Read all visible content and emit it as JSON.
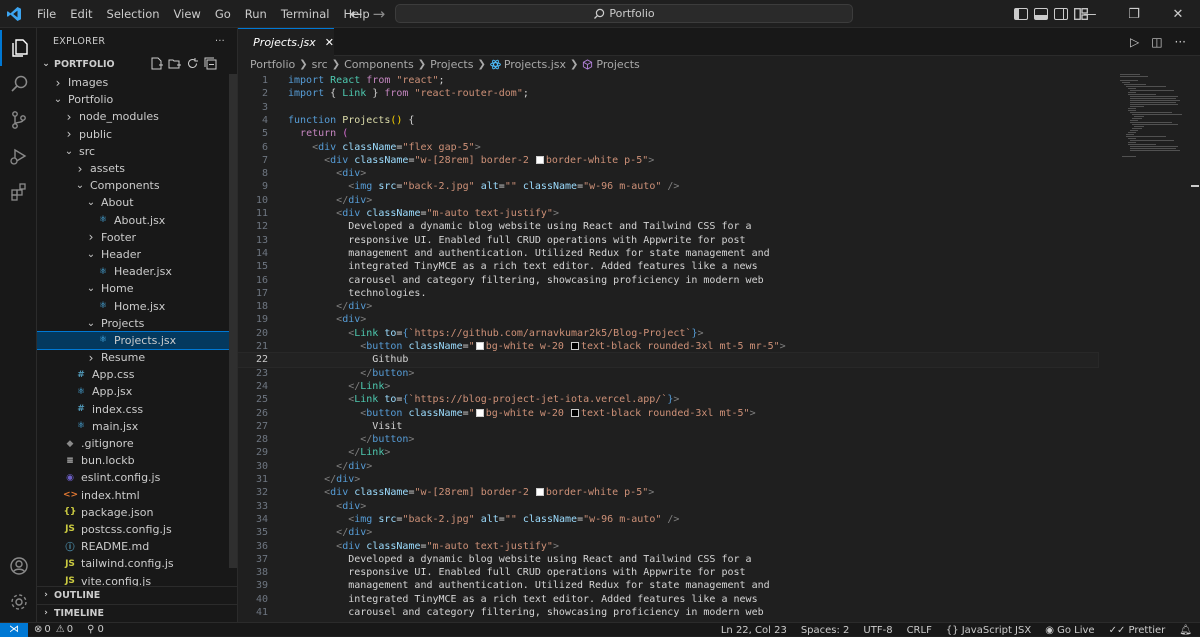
{
  "menu": [
    "File",
    "Edit",
    "Selection",
    "View",
    "Go",
    "Run",
    "Terminal",
    "Help"
  ],
  "command_center": "Portfolio",
  "explorer": {
    "title": "EXPLORER",
    "more": "···",
    "project": "PORTFOLIO",
    "tree": [
      {
        "label": "Images",
        "depth": 1,
        "type": "folder",
        "open": false
      },
      {
        "label": "Portfolio",
        "depth": 1,
        "type": "folder",
        "open": true
      },
      {
        "label": "node_modules",
        "depth": 2,
        "type": "folder",
        "open": false
      },
      {
        "label": "public",
        "depth": 2,
        "type": "folder",
        "open": false
      },
      {
        "label": "src",
        "depth": 2,
        "type": "folder",
        "open": true
      },
      {
        "label": "assets",
        "depth": 3,
        "type": "folder",
        "open": false
      },
      {
        "label": "Components",
        "depth": 3,
        "type": "folder",
        "open": true
      },
      {
        "label": "About",
        "depth": 4,
        "type": "folder",
        "open": true
      },
      {
        "label": "About.jsx",
        "depth": 5,
        "type": "react"
      },
      {
        "label": "Footer",
        "depth": 4,
        "type": "folder",
        "open": false
      },
      {
        "label": "Header",
        "depth": 4,
        "type": "folder",
        "open": true
      },
      {
        "label": "Header.jsx",
        "depth": 5,
        "type": "react"
      },
      {
        "label": "Home",
        "depth": 4,
        "type": "folder",
        "open": true
      },
      {
        "label": "Home.jsx",
        "depth": 5,
        "type": "react"
      },
      {
        "label": "Projects",
        "depth": 4,
        "type": "folder",
        "open": true
      },
      {
        "label": "Projects.jsx",
        "depth": 5,
        "type": "react",
        "selected": true
      },
      {
        "label": "Resume",
        "depth": 4,
        "type": "folder",
        "open": false
      },
      {
        "label": "App.css",
        "depth": 3,
        "type": "css"
      },
      {
        "label": "App.jsx",
        "depth": 3,
        "type": "react"
      },
      {
        "label": "index.css",
        "depth": 3,
        "type": "css"
      },
      {
        "label": "main.jsx",
        "depth": 3,
        "type": "react"
      },
      {
        "label": ".gitignore",
        "depth": 2,
        "type": "git"
      },
      {
        "label": "bun.lockb",
        "depth": 2,
        "type": "lock"
      },
      {
        "label": "eslint.config.js",
        "depth": 2,
        "type": "eslint"
      },
      {
        "label": "index.html",
        "depth": 2,
        "type": "html"
      },
      {
        "label": "package.json",
        "depth": 2,
        "type": "json"
      },
      {
        "label": "postcss.config.js",
        "depth": 2,
        "type": "js"
      },
      {
        "label": "README.md",
        "depth": 2,
        "type": "info"
      },
      {
        "label": "tailwind.config.js",
        "depth": 2,
        "type": "js"
      },
      {
        "label": "vite.config.js",
        "depth": 2,
        "type": "js"
      }
    ],
    "outline": "OUTLINE",
    "timeline": "TIMELINE"
  },
  "tab": {
    "label": "Projects.jsx"
  },
  "breadcrumb": [
    "Portfolio",
    "src",
    "Components",
    "Projects",
    "Projects.jsx",
    "Projects"
  ],
  "current_line": 22,
  "code": [
    [
      [
        "k",
        "import "
      ],
      [
        "c",
        "React "
      ],
      [
        "kc",
        "from "
      ],
      [
        "s",
        "\"react\""
      ],
      [
        "w",
        ";"
      ]
    ],
    [
      [
        "k",
        "import "
      ],
      [
        "w",
        "{ "
      ],
      [
        "c",
        "Link "
      ],
      [
        "w",
        "} "
      ],
      [
        "kc",
        "from "
      ],
      [
        "s",
        "\"react-router-dom\""
      ],
      [
        "w",
        ";"
      ]
    ],
    [],
    [
      [
        "k",
        "function "
      ],
      [
        "f",
        "Projects"
      ],
      [
        "y",
        "()"
      ],
      [
        "w",
        " {"
      ]
    ],
    [
      [
        "w",
        "  "
      ],
      [
        "kc",
        "return "
      ],
      [
        "p",
        "("
      ]
    ],
    [
      [
        "w",
        "    "
      ],
      [
        "g",
        "<"
      ],
      [
        "t",
        "div "
      ],
      [
        "v",
        "className"
      ],
      [
        "w",
        "="
      ],
      [
        "s",
        "\"flex gap-5\""
      ],
      [
        "g",
        ">"
      ]
    ],
    [
      [
        "w",
        "      "
      ],
      [
        "g",
        "<"
      ],
      [
        "t",
        "div "
      ],
      [
        "v",
        "className"
      ],
      [
        "w",
        "="
      ],
      [
        "s",
        "\"w-[28rem] border-2 "
      ],
      [
        "sw",
        "w"
      ],
      [
        "s",
        "border-white p-5\""
      ],
      [
        "g",
        ">"
      ]
    ],
    [
      [
        "w",
        "        "
      ],
      [
        "g",
        "<"
      ],
      [
        "t",
        "div"
      ],
      [
        "g",
        ">"
      ]
    ],
    [
      [
        "w",
        "          "
      ],
      [
        "g",
        "<"
      ],
      [
        "t",
        "img "
      ],
      [
        "v",
        "src"
      ],
      [
        "w",
        "="
      ],
      [
        "s",
        "\"back-2.jpg\" "
      ],
      [
        "v",
        "alt"
      ],
      [
        "w",
        "="
      ],
      [
        "s",
        "\"\" "
      ],
      [
        "v",
        "className"
      ],
      [
        "w",
        "="
      ],
      [
        "s",
        "\"w-96 m-auto\" "
      ],
      [
        "g",
        "/>"
      ]
    ],
    [
      [
        "w",
        "        "
      ],
      [
        "g",
        "</"
      ],
      [
        "t",
        "div"
      ],
      [
        "g",
        ">"
      ]
    ],
    [
      [
        "w",
        "        "
      ],
      [
        "g",
        "<"
      ],
      [
        "t",
        "div "
      ],
      [
        "v",
        "className"
      ],
      [
        "w",
        "="
      ],
      [
        "s",
        "\"m-auto text-justify\""
      ],
      [
        "g",
        ">"
      ]
    ],
    [
      [
        "w",
        "          Developed a dynamic blog website using React and Tailwind CSS for a"
      ]
    ],
    [
      [
        "w",
        "          responsive UI. Enabled full CRUD operations with Appwrite for post"
      ]
    ],
    [
      [
        "w",
        "          management and authentication. Utilized Redux for state management and"
      ]
    ],
    [
      [
        "w",
        "          integrated TinyMCE as a rich text editor. Added features like a news"
      ]
    ],
    [
      [
        "w",
        "          carousel and category filtering, showcasing proficiency in modern web"
      ]
    ],
    [
      [
        "w",
        "          technologies."
      ]
    ],
    [
      [
        "w",
        "        "
      ],
      [
        "g",
        "</"
      ],
      [
        "t",
        "div"
      ],
      [
        "g",
        ">"
      ]
    ],
    [
      [
        "w",
        "        "
      ],
      [
        "g",
        "<"
      ],
      [
        "t",
        "div"
      ],
      [
        "g",
        ">"
      ]
    ],
    [
      [
        "w",
        "          "
      ],
      [
        "g",
        "<"
      ],
      [
        "c",
        "Link "
      ],
      [
        "v",
        "to"
      ],
      [
        "w",
        "="
      ],
      [
        "k",
        "{"
      ],
      [
        "s",
        "`https://github.com/arnavkumar2k5/Blog-Project`"
      ],
      [
        "k",
        "}"
      ],
      [
        "g",
        ">"
      ]
    ],
    [
      [
        "w",
        "            "
      ],
      [
        "g",
        "<"
      ],
      [
        "t",
        "button "
      ],
      [
        "v",
        "className"
      ],
      [
        "w",
        "="
      ],
      [
        "s",
        "\""
      ],
      [
        "sw",
        "w"
      ],
      [
        "s",
        "bg-white w-20 "
      ],
      [
        "sw",
        "b"
      ],
      [
        "s",
        "text-black rounded-3xl mt-5 mr-5\""
      ],
      [
        "g",
        ">"
      ]
    ],
    [
      [
        "w",
        "              Github"
      ]
    ],
    [
      [
        "w",
        "            "
      ],
      [
        "g",
        "</"
      ],
      [
        "t",
        "button"
      ],
      [
        "g",
        ">"
      ]
    ],
    [
      [
        "w",
        "          "
      ],
      [
        "g",
        "</"
      ],
      [
        "c",
        "Link"
      ],
      [
        "g",
        ">"
      ]
    ],
    [
      [
        "w",
        "          "
      ],
      [
        "g",
        "<"
      ],
      [
        "c",
        "Link "
      ],
      [
        "v",
        "to"
      ],
      [
        "w",
        "="
      ],
      [
        "k",
        "{"
      ],
      [
        "s",
        "`https://blog-project-jet-iota.vercel.app/`"
      ],
      [
        "k",
        "}"
      ],
      [
        "g",
        ">"
      ]
    ],
    [
      [
        "w",
        "            "
      ],
      [
        "g",
        "<"
      ],
      [
        "t",
        "button "
      ],
      [
        "v",
        "className"
      ],
      [
        "w",
        "="
      ],
      [
        "s",
        "\""
      ],
      [
        "sw",
        "w"
      ],
      [
        "s",
        "bg-white w-20 "
      ],
      [
        "sw",
        "b"
      ],
      [
        "s",
        "text-black rounded-3xl mt-5\""
      ],
      [
        "g",
        ">"
      ]
    ],
    [
      [
        "w",
        "              Visit"
      ]
    ],
    [
      [
        "w",
        "            "
      ],
      [
        "g",
        "</"
      ],
      [
        "t",
        "button"
      ],
      [
        "g",
        ">"
      ]
    ],
    [
      [
        "w",
        "          "
      ],
      [
        "g",
        "</"
      ],
      [
        "c",
        "Link"
      ],
      [
        "g",
        ">"
      ]
    ],
    [
      [
        "w",
        "        "
      ],
      [
        "g",
        "</"
      ],
      [
        "t",
        "div"
      ],
      [
        "g",
        ">"
      ]
    ],
    [
      [
        "w",
        "      "
      ],
      [
        "g",
        "</"
      ],
      [
        "t",
        "div"
      ],
      [
        "g",
        ">"
      ]
    ],
    [
      [
        "w",
        "      "
      ],
      [
        "g",
        "<"
      ],
      [
        "t",
        "div "
      ],
      [
        "v",
        "className"
      ],
      [
        "w",
        "="
      ],
      [
        "s",
        "\"w-[28rem] border-2 "
      ],
      [
        "sw",
        "w"
      ],
      [
        "s",
        "border-white p-5\""
      ],
      [
        "g",
        ">"
      ]
    ],
    [
      [
        "w",
        "        "
      ],
      [
        "g",
        "<"
      ],
      [
        "t",
        "div"
      ],
      [
        "g",
        ">"
      ]
    ],
    [
      [
        "w",
        "          "
      ],
      [
        "g",
        "<"
      ],
      [
        "t",
        "img "
      ],
      [
        "v",
        "src"
      ],
      [
        "w",
        "="
      ],
      [
        "s",
        "\"back-2.jpg\" "
      ],
      [
        "v",
        "alt"
      ],
      [
        "w",
        "="
      ],
      [
        "s",
        "\"\" "
      ],
      [
        "v",
        "className"
      ],
      [
        "w",
        "="
      ],
      [
        "s",
        "\"w-96 m-auto\" "
      ],
      [
        "g",
        "/>"
      ]
    ],
    [
      [
        "w",
        "        "
      ],
      [
        "g",
        "</"
      ],
      [
        "t",
        "div"
      ],
      [
        "g",
        ">"
      ]
    ],
    [
      [
        "w",
        "        "
      ],
      [
        "g",
        "<"
      ],
      [
        "t",
        "div "
      ],
      [
        "v",
        "className"
      ],
      [
        "w",
        "="
      ],
      [
        "s",
        "\"m-auto text-justify\""
      ],
      [
        "g",
        ">"
      ]
    ],
    [
      [
        "w",
        "          Developed a dynamic blog website using React and Tailwind CSS for a"
      ]
    ],
    [
      [
        "w",
        "          responsive UI. Enabled full CRUD operations with Appwrite for post"
      ]
    ],
    [
      [
        "w",
        "          management and authentication. Utilized Redux for state management and"
      ]
    ],
    [
      [
        "w",
        "          integrated TinyMCE as a rich text editor. Added features like a news"
      ]
    ],
    [
      [
        "w",
        "          carousel and category filtering, showcasing proficiency in modern web"
      ]
    ]
  ],
  "status": {
    "errors": "0",
    "warnings": "0",
    "ports": "0",
    "position": "Ln 22, Col 23",
    "spaces": "Spaces: 2",
    "encoding": "UTF-8",
    "eol": "CRLF",
    "language": "JavaScript JSX",
    "golive": "Go Live",
    "prettier": "Prettier"
  },
  "colors": {
    "accent": "#0078d4",
    "background": "#1f1f1f",
    "sidebar": "#181818"
  }
}
